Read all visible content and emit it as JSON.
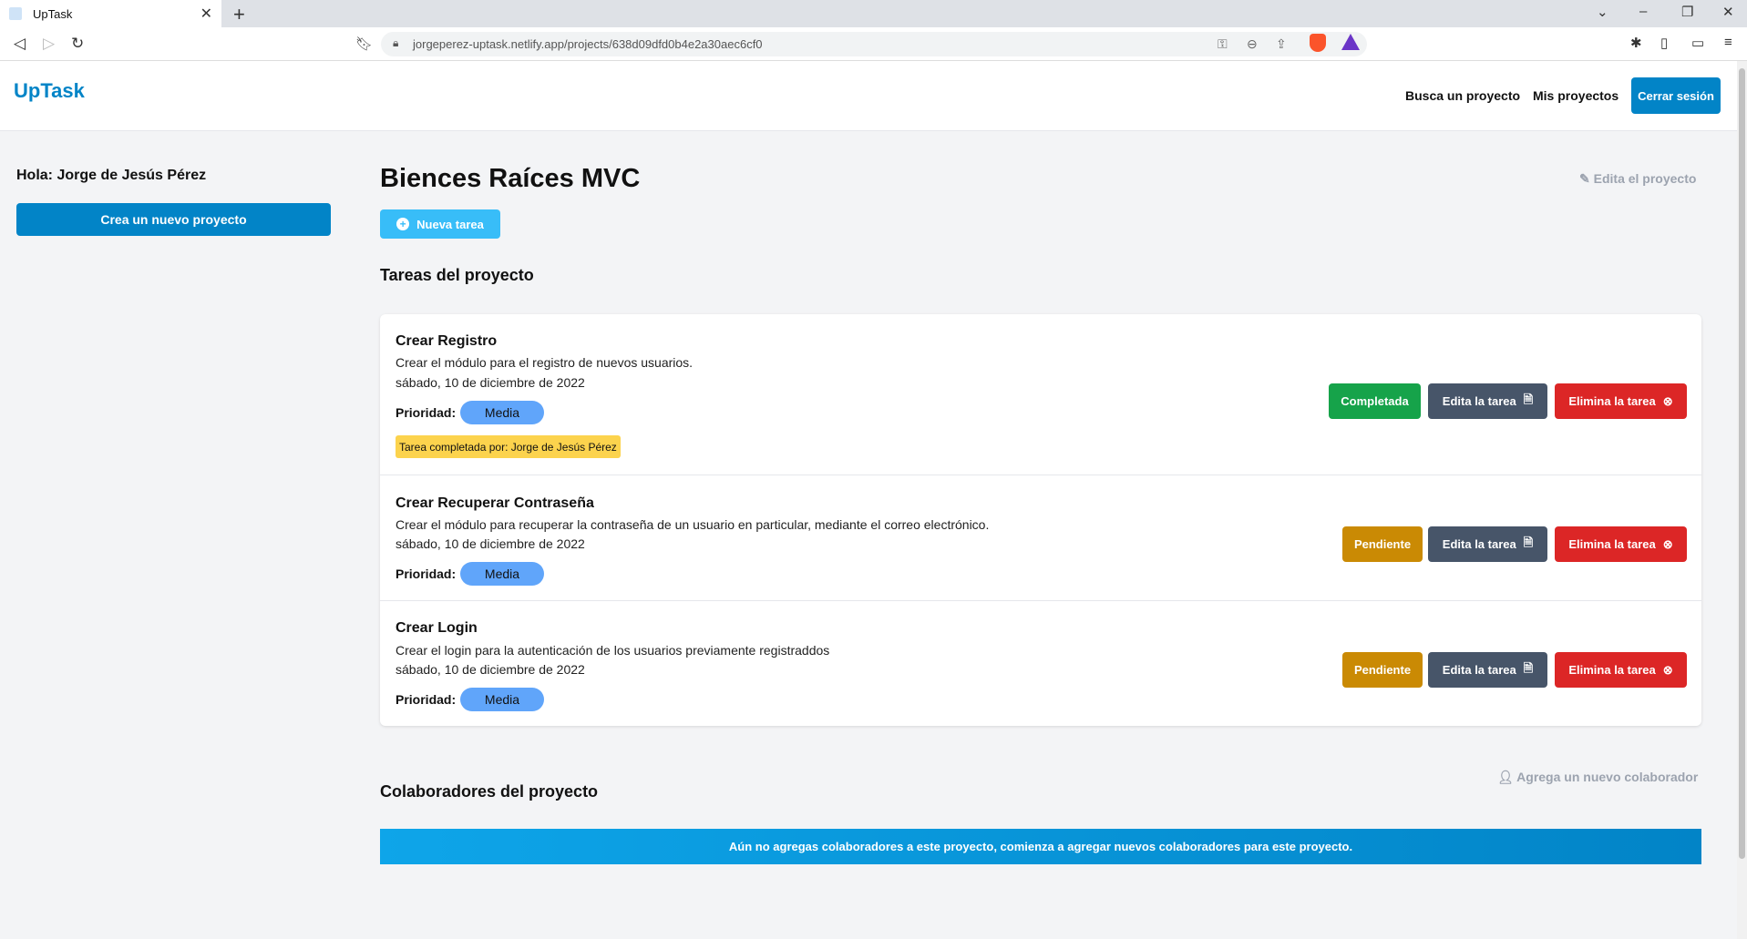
{
  "browser": {
    "tab_title": "UpTask",
    "tab_close": "✕",
    "new_tab": "+",
    "url": "jorgeperez-uptask.netlify.app/projects/638d09dfd0b4e2a30aec6cf0",
    "icons": [
      "back-icon",
      "forward-icon",
      "reload-icon",
      "bookmark-icon",
      "lock-icon",
      "key-icon",
      "zoom-icon",
      "share-icon",
      "brave-shield-icon",
      "brave-rewards-icon",
      "extensions-icon",
      "sidebar-icon",
      "wallet-icon",
      "menu-icon"
    ]
  },
  "header": {
    "logo": "UpTask",
    "nav": {
      "search": "Busca un proyecto",
      "my_projects": "Mis proyectos"
    },
    "logout": "Cerrar sesión"
  },
  "sidebar": {
    "greeting": "Hola: Jorge de Jesús Pérez",
    "new_project": "Crea un nuevo proyecto"
  },
  "project": {
    "title": "Biences Raíces MVC",
    "edit_label": "Edita el proyecto",
    "new_task": "Nueva tarea",
    "tasks_heading": "Tareas del proyecto",
    "tasks": [
      {
        "name": "Crear Registro",
        "description": "Crear el módulo para el registro de nuevos usuarios.",
        "date": "sábado, 10 de diciembre de 2022",
        "priority_label": "Prioridad:",
        "priority": "Media",
        "status": "Completada",
        "completed_by": "Tarea completada por: Jorge de Jesús Pérez",
        "edit": "Edita la tarea",
        "delete": "Elimina la tarea"
      },
      {
        "name": "Crear Recuperar Contraseña",
        "description": "Crear el módulo para recuperar la contraseña de un usuario en particular, mediante el correo electrónico.",
        "date": "sábado, 10 de diciembre de 2022",
        "priority_label": "Prioridad:",
        "priority": "Media",
        "status": "Pendiente",
        "edit": "Edita la tarea",
        "delete": "Elimina la tarea"
      },
      {
        "name": "Crear Login",
        "description": "Crear el login para la autenticación de los usuarios previamente registraddos",
        "date": "sábado, 10 de diciembre de 2022",
        "priority_label": "Prioridad:",
        "priority": "Media",
        "status": "Pendiente",
        "edit": "Edita la tarea",
        "delete": "Elimina la tarea"
      }
    ],
    "collaborators_heading": "Colaboradores del proyecto",
    "add_collaborator": "Agrega un nuevo colaborador",
    "no_collaborators": "Aún no agregas colaboradores a este proyecto, comienza a agregar nuevos colaboradores para este proyecto."
  },
  "colors": {
    "brand": "#0284c7",
    "completed": "#16a34a",
    "pending": "#ca8a04",
    "edit": "#475569",
    "delete": "#dc2626",
    "priority": "#60a5fa",
    "completed_by_bg": "#fcd34d"
  }
}
